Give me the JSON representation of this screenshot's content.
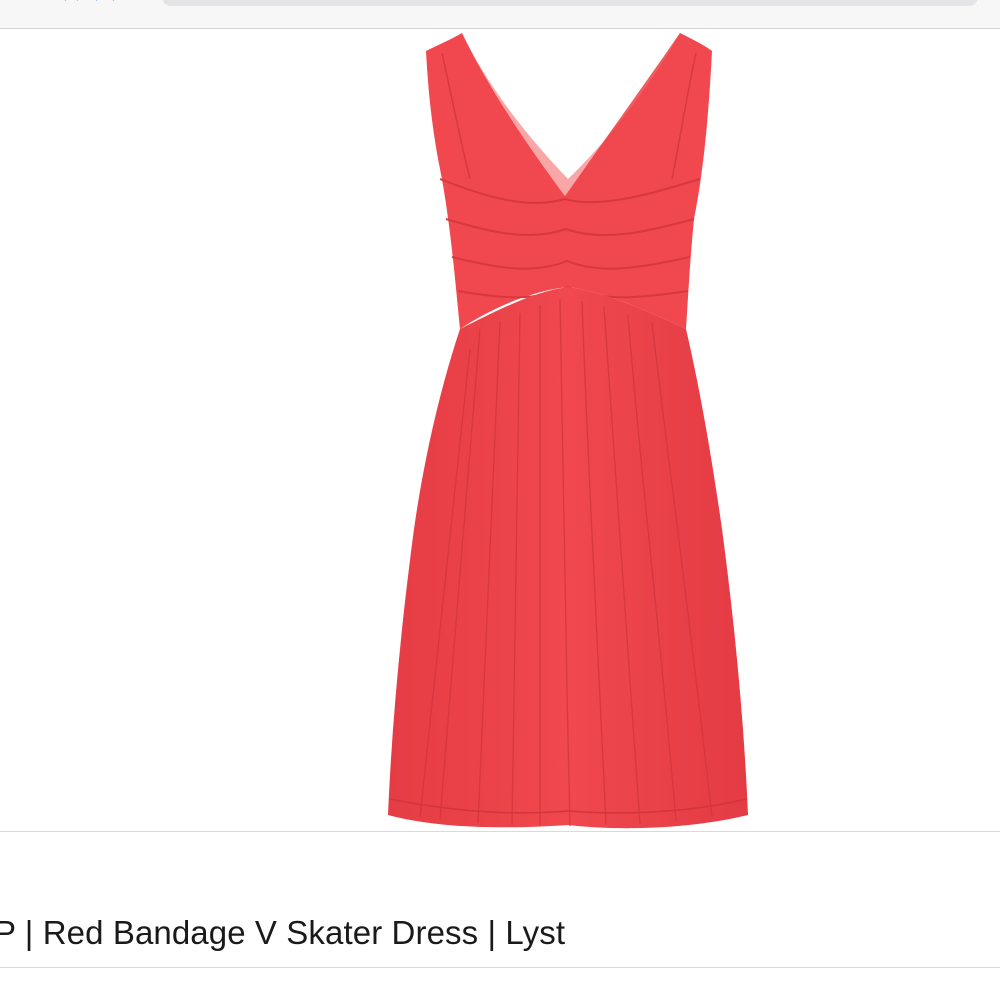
{
  "browser": {
    "address_field": ""
  },
  "result": {
    "title": "P | Red Bandage V Skater Dress | Lyst"
  },
  "image": {
    "subject": "red-sleeveless-v-neck-skater-dress",
    "dress_color": "#f0484e",
    "dress_shadow_color": "#dd3a42",
    "dress_highlight_color": "#f66a6c"
  }
}
